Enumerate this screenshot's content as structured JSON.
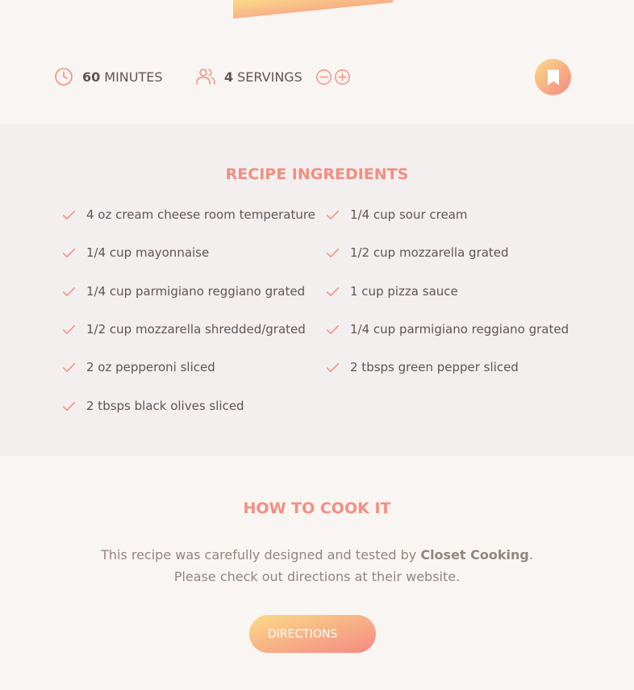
{
  "recipe": {
    "cooking_time": "60",
    "cooking_time_unit": "MINUTES",
    "servings": "4",
    "servings_unit": "SERVINGS"
  },
  "ingredients": {
    "heading": "RECIPE INGREDIENTS",
    "items": [
      "4 oz cream cheese room temperature",
      "1/4 cup sour cream",
      "1/4 cup mayonnaise",
      "1/2 cup mozzarella grated",
      "1/4 cup parmigiano reggiano grated",
      "1 cup pizza sauce",
      "1/2 cup mozzarella shredded/grated",
      "1/4 cup parmigiano reggiano grated",
      "2 oz pepperoni sliced",
      "2 tbsps green pepper sliced",
      "2 tbsps black olives sliced"
    ]
  },
  "directions": {
    "heading": "HOW TO COOK IT",
    "text_before": "This recipe was carefully designed and tested by ",
    "publisher": "Closet Cooking",
    "text_after": ". Please check out directions at their website.",
    "button_label": "DIRECTIONS"
  },
  "icons": {
    "time": "clock-icon",
    "servings": "users-icon",
    "decrease": "minus-circle-icon",
    "increase": "plus-circle-icon",
    "bookmark": "bookmark-icon",
    "check": "check-icon"
  },
  "colors": {
    "accent": "#f38e82",
    "gradient_start": "#fbdb89",
    "gradient_end": "#f48982",
    "text": "#615551",
    "text_light": "#918581",
    "background": "#f9f5f2",
    "ingredients_bg": "#f2efee"
  }
}
